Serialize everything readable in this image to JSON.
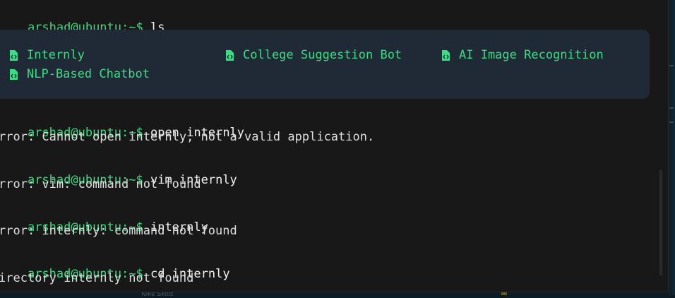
{
  "colors": {
    "terminal_bg": "#181818",
    "prompt": "#3ddc84",
    "ls_panel": "#1f2a36",
    "text": "#e6e6e6"
  },
  "session": [
    {
      "prompt": "arshad@ubuntu:~$",
      "command": "ls"
    },
    {
      "prompt": "arshad@ubuntu:~$",
      "command": "open internly",
      "output": "rror: Cannot open internly, not a valid application."
    },
    {
      "prompt": "arshad@ubuntu:~$",
      "command": "vim internly",
      "output": "rror: vim: command not found"
    },
    {
      "prompt": "arshad@ubuntu:~$",
      "command": "internly",
      "output": "rror: internly: command not found"
    },
    {
      "prompt": "arshad@ubuntu:~$",
      "command": "cd internly",
      "output": "irectory internly not found"
    }
  ],
  "ls_results": [
    {
      "name": "Internly",
      "icon": "code-file-icon"
    },
    {
      "name": "College Suggestion Bot",
      "icon": "code-file-icon"
    },
    {
      "name": "AI Image Recognition",
      "icon": "code-file-icon"
    },
    {
      "name": "NLP-Based Chatbot",
      "icon": "code-file-icon"
    }
  ],
  "background": {
    "bottom_text": "Nike Skills"
  }
}
